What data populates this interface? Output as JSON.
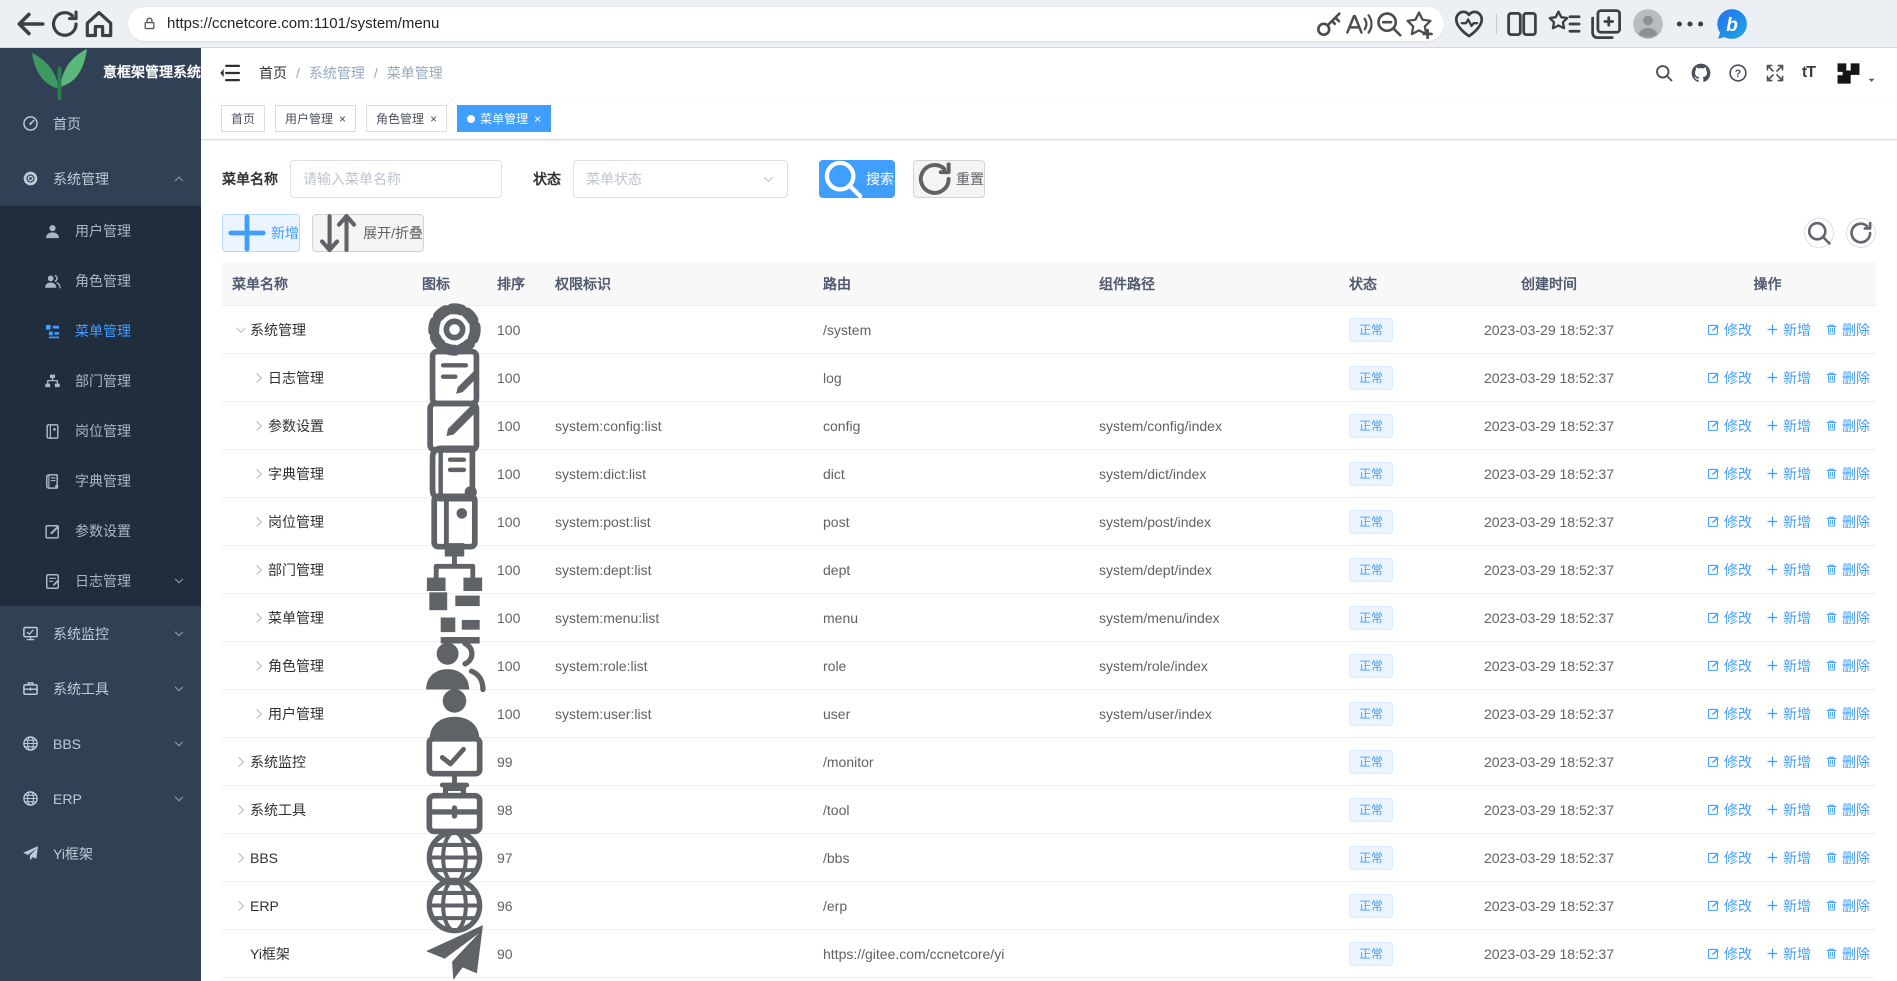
{
  "browser": {
    "url": "https://ccnetcore.com:1101/system/menu"
  },
  "sidebar": {
    "logo_title": "意框架管理系统",
    "items": [
      {
        "label": "首页",
        "icon": "gauge",
        "type": "item"
      },
      {
        "label": "系统管理",
        "icon": "gear",
        "type": "group-open",
        "arrow": "up"
      },
      {
        "label": "用户管理",
        "icon": "user",
        "type": "child"
      },
      {
        "label": "角色管理",
        "icon": "role",
        "type": "child"
      },
      {
        "label": "菜单管理",
        "icon": "menu",
        "type": "child",
        "active": true
      },
      {
        "label": "部门管理",
        "icon": "dept",
        "type": "child"
      },
      {
        "label": "岗位管理",
        "icon": "post",
        "type": "child"
      },
      {
        "label": "字典管理",
        "icon": "dict",
        "type": "child"
      },
      {
        "label": "参数设置",
        "icon": "edit",
        "type": "child"
      },
      {
        "label": "日志管理",
        "icon": "log",
        "type": "child",
        "arrow": "down"
      },
      {
        "label": "系统监控",
        "icon": "monitor",
        "type": "item",
        "arrow": "down"
      },
      {
        "label": "系统工具",
        "icon": "tool",
        "type": "item",
        "arrow": "down"
      },
      {
        "label": "BBS",
        "icon": "globe",
        "type": "item",
        "arrow": "down"
      },
      {
        "label": "ERP",
        "icon": "globe",
        "type": "item",
        "arrow": "down"
      },
      {
        "label": "Yi框架",
        "icon": "send",
        "type": "item"
      }
    ]
  },
  "header": {
    "breadcrumb": [
      "首页",
      "系统管理",
      "菜单管理"
    ],
    "fontsize_label": "tT"
  },
  "tabs": [
    {
      "label": "首页",
      "closable": false,
      "active": false
    },
    {
      "label": "用户管理",
      "closable": true,
      "active": false
    },
    {
      "label": "角色管理",
      "closable": true,
      "active": false
    },
    {
      "label": "菜单管理",
      "closable": true,
      "active": true
    }
  ],
  "filters": {
    "name_label": "菜单名称",
    "name_placeholder": "请输入菜单名称",
    "name_value": "",
    "status_label": "状态",
    "status_placeholder": "菜单状态",
    "search_label": "搜索",
    "reset_label": "重置"
  },
  "toolbar": {
    "add_label": "新增",
    "expand_label": "展开/折叠"
  },
  "table": {
    "columns": [
      "菜单名称",
      "图标",
      "排序",
      "权限标识",
      "路由",
      "组件路径",
      "状态",
      "创建时间",
      "操作"
    ],
    "actions": {
      "edit": "修改",
      "add": "新增",
      "delete": "删除"
    },
    "rows": [
      {
        "name": "系统管理",
        "icon": "gear",
        "level": 0,
        "chevron": "expanded",
        "order": "100",
        "perm": "",
        "route": "/system",
        "component": "",
        "status": "正常",
        "created": "2023-03-29 18:52:37"
      },
      {
        "name": "日志管理",
        "icon": "log",
        "level": 1,
        "chevron": "collapsed",
        "order": "100",
        "perm": "",
        "route": "log",
        "component": "",
        "status": "正常",
        "created": "2023-03-29 18:52:37"
      },
      {
        "name": "参数设置",
        "icon": "edit",
        "level": 1,
        "chevron": "collapsed",
        "order": "100",
        "perm": "system:config:list",
        "route": "config",
        "component": "system/config/index",
        "status": "正常",
        "created": "2023-03-29 18:52:37"
      },
      {
        "name": "字典管理",
        "icon": "dict",
        "level": 1,
        "chevron": "collapsed",
        "order": "100",
        "perm": "system:dict:list",
        "route": "dict",
        "component": "system/dict/index",
        "status": "正常",
        "created": "2023-03-29 18:52:37"
      },
      {
        "name": "岗位管理",
        "icon": "post",
        "level": 1,
        "chevron": "collapsed",
        "order": "100",
        "perm": "system:post:list",
        "route": "post",
        "component": "system/post/index",
        "status": "正常",
        "created": "2023-03-29 18:52:37"
      },
      {
        "name": "部门管理",
        "icon": "dept",
        "level": 1,
        "chevron": "collapsed",
        "order": "100",
        "perm": "system:dept:list",
        "route": "dept",
        "component": "system/dept/index",
        "status": "正常",
        "created": "2023-03-29 18:52:37"
      },
      {
        "name": "菜单管理",
        "icon": "menu",
        "level": 1,
        "chevron": "collapsed",
        "order": "100",
        "perm": "system:menu:list",
        "route": "menu",
        "component": "system/menu/index",
        "status": "正常",
        "created": "2023-03-29 18:52:37"
      },
      {
        "name": "角色管理",
        "icon": "role",
        "level": 1,
        "chevron": "collapsed",
        "order": "100",
        "perm": "system:role:list",
        "route": "role",
        "component": "system/role/index",
        "status": "正常",
        "created": "2023-03-29 18:52:37"
      },
      {
        "name": "用户管理",
        "icon": "user",
        "level": 1,
        "chevron": "collapsed",
        "order": "100",
        "perm": "system:user:list",
        "route": "user",
        "component": "system/user/index",
        "status": "正常",
        "created": "2023-03-29 18:52:37"
      },
      {
        "name": "系统监控",
        "icon": "monitor",
        "level": 0,
        "chevron": "collapsed",
        "order": "99",
        "perm": "",
        "route": "/monitor",
        "component": "",
        "status": "正常",
        "created": "2023-03-29 18:52:37"
      },
      {
        "name": "系统工具",
        "icon": "tool",
        "level": 0,
        "chevron": "collapsed",
        "order": "98",
        "perm": "",
        "route": "/tool",
        "component": "",
        "status": "正常",
        "created": "2023-03-29 18:52:37"
      },
      {
        "name": "BBS",
        "icon": "globe",
        "level": 0,
        "chevron": "collapsed",
        "order": "97",
        "perm": "",
        "route": "/bbs",
        "component": "",
        "status": "正常",
        "created": "2023-03-29 18:52:37"
      },
      {
        "name": "ERP",
        "icon": "globe",
        "level": 0,
        "chevron": "collapsed",
        "order": "96",
        "perm": "",
        "route": "/erp",
        "component": "",
        "status": "正常",
        "created": "2023-03-29 18:52:37"
      },
      {
        "name": "Yi框架",
        "icon": "send",
        "level": 0,
        "chevron": "none",
        "order": "90",
        "perm": "",
        "route": "https://gitee.com/ccnetcore/yi",
        "component": "",
        "status": "正常",
        "created": "2023-03-29 18:52:37"
      }
    ]
  },
  "colors": {
    "primary": "#409eff",
    "sidebar_bg": "#304156",
    "submenu_bg": "#1f2d3d",
    "status_tag_bg": "#ecf5ff"
  }
}
